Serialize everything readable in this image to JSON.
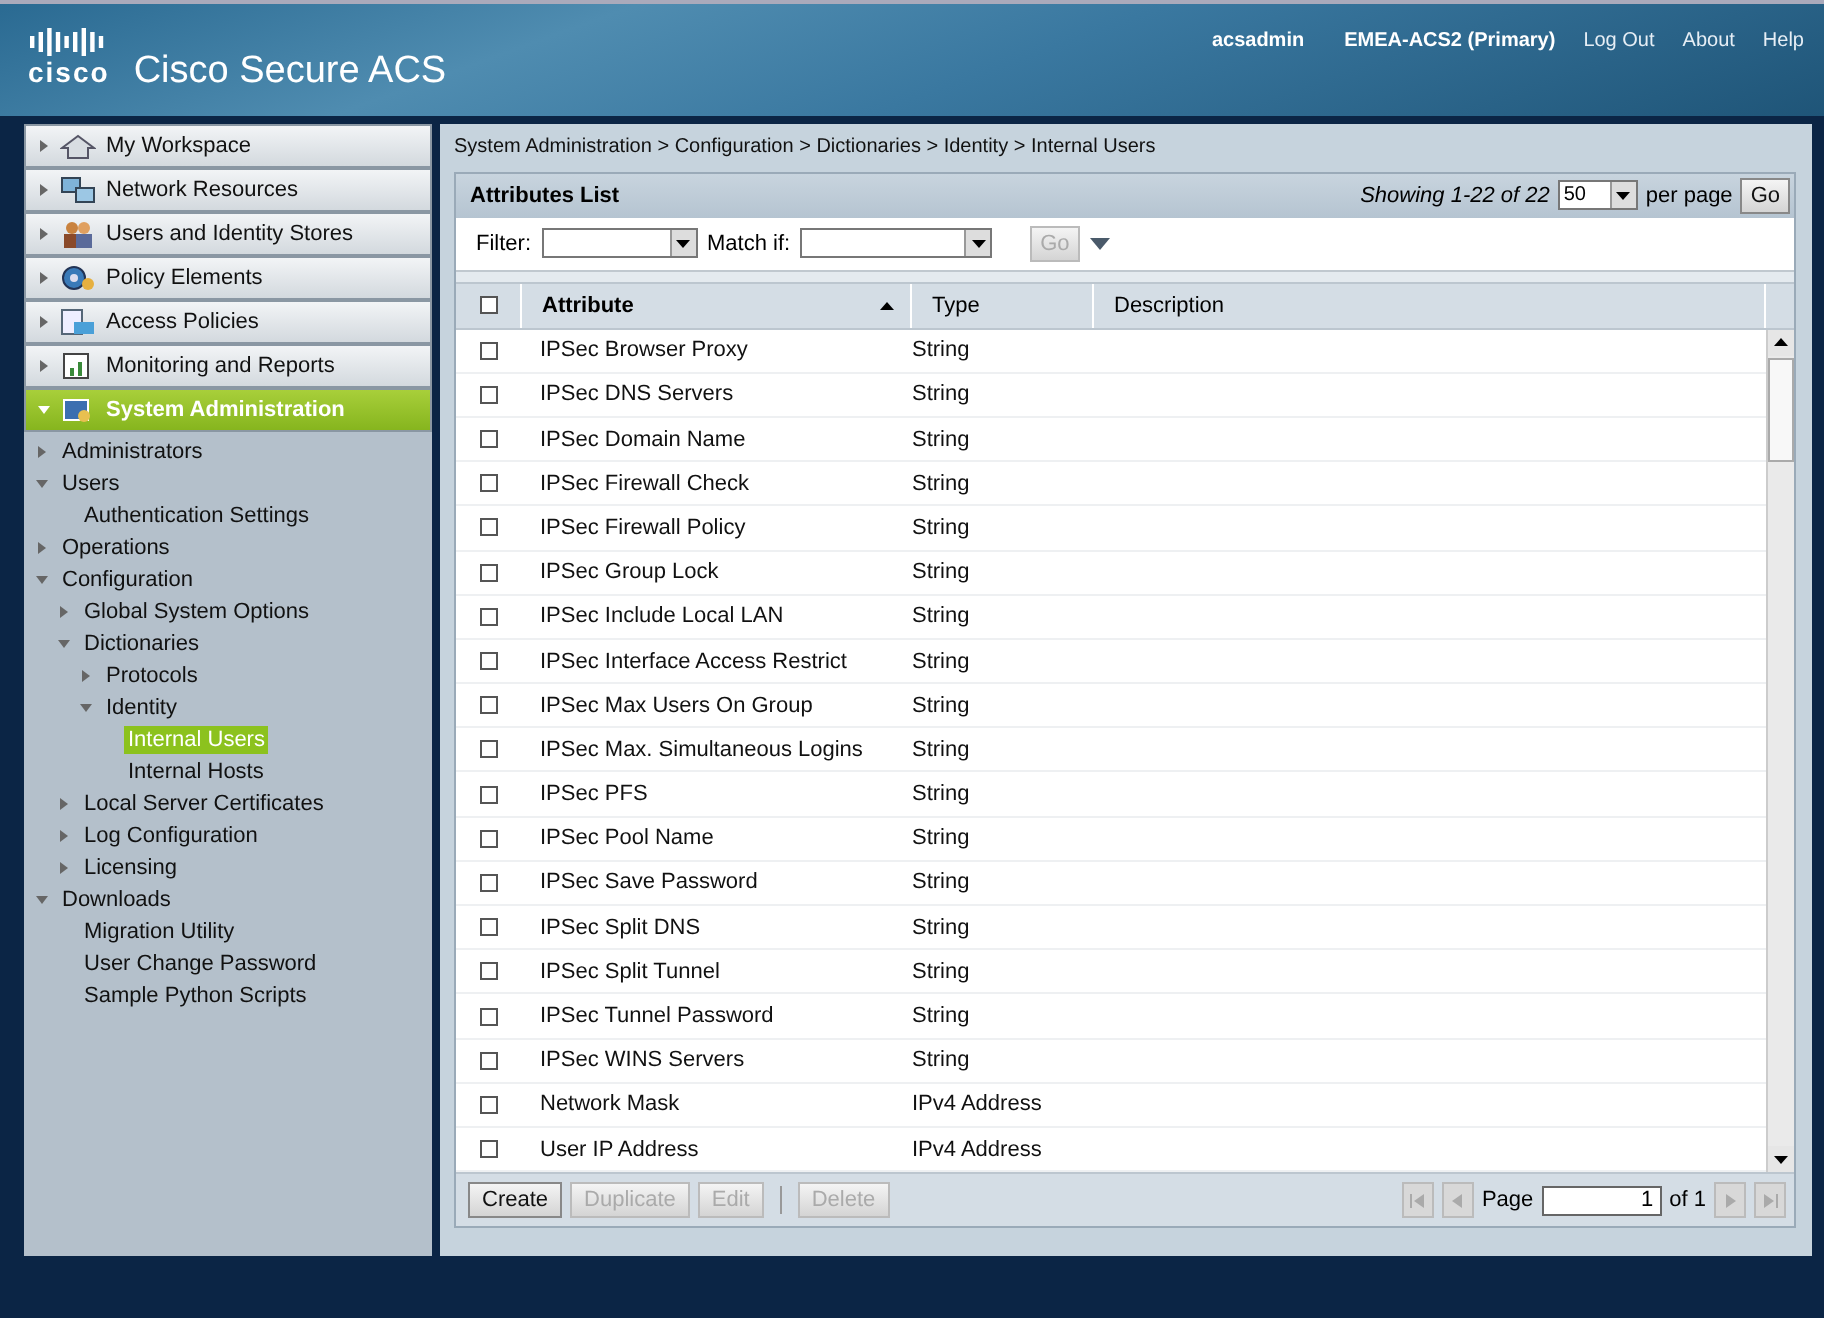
{
  "header": {
    "logo": "cisco",
    "product": "Cisco Secure ACS",
    "user": "acsadmin",
    "server": "EMEA-ACS2 (Primary)",
    "links": [
      "Log Out",
      "About",
      "Help"
    ]
  },
  "nav": [
    {
      "label": "My Workspace",
      "selected": false
    },
    {
      "label": "Network Resources",
      "selected": false
    },
    {
      "label": "Users and Identity Stores",
      "selected": false
    },
    {
      "label": "Policy Elements",
      "selected": false
    },
    {
      "label": "Access Policies",
      "selected": false
    },
    {
      "label": "Monitoring and Reports",
      "selected": false
    },
    {
      "label": "System Administration",
      "selected": true
    }
  ],
  "tree": [
    {
      "label": "Administrators",
      "expanded": false,
      "selected": false
    },
    {
      "label": "Users",
      "expanded": true,
      "selected": false,
      "children": [
        {
          "label": "Authentication Settings",
          "selected": false
        }
      ]
    },
    {
      "label": "Operations",
      "expanded": false,
      "selected": false
    },
    {
      "label": "Configuration",
      "expanded": true,
      "selected": false,
      "children": [
        {
          "label": "Global System Options",
          "expanded": false,
          "selected": false
        },
        {
          "label": "Dictionaries",
          "expanded": true,
          "selected": false,
          "children": [
            {
              "label": "Protocols",
              "expanded": false,
              "selected": false
            },
            {
              "label": "Identity",
              "expanded": true,
              "selected": false,
              "children": [
                {
                  "label": "Internal Users",
                  "selected": true
                },
                {
                  "label": "Internal Hosts",
                  "selected": false
                }
              ]
            }
          ]
        },
        {
          "label": "Local Server Certificates",
          "expanded": false,
          "selected": false
        },
        {
          "label": "Log Configuration",
          "expanded": false,
          "selected": false
        },
        {
          "label": "Licensing",
          "expanded": false,
          "selected": false
        }
      ]
    },
    {
      "label": "Downloads",
      "expanded": true,
      "selected": false,
      "children": [
        {
          "label": "Migration Utility",
          "selected": false
        },
        {
          "label": "User Change Password",
          "selected": false
        },
        {
          "label": "Sample Python Scripts",
          "selected": false
        }
      ]
    }
  ],
  "breadcrumb": "System Administration > Configuration > Dictionaries > Identity > Internal Users",
  "list": {
    "title": "Attributes List",
    "showing": "Showing 1-22 of 22",
    "per_page": "50",
    "per_page_label": "per page",
    "go": "Go"
  },
  "filter": {
    "filter_label": "Filter:",
    "match_label": "Match if:",
    "go": "Go",
    "go_disabled": true
  },
  "table": {
    "header_checked": false,
    "columns": [
      "Attribute",
      "Type",
      "Description"
    ],
    "rows": [
      {
        "attribute": "IPSec Browser Proxy",
        "type": "String",
        "checked": false
      },
      {
        "attribute": "IPSec DNS Servers",
        "type": "String",
        "checked": false
      },
      {
        "attribute": "IPSec Domain Name",
        "type": "String",
        "checked": false
      },
      {
        "attribute": "IPSec Firewall Check",
        "type": "String",
        "checked": false
      },
      {
        "attribute": "IPSec Firewall Policy",
        "type": "String",
        "checked": false
      },
      {
        "attribute": "IPSec Group Lock",
        "type": "String",
        "checked": false
      },
      {
        "attribute": "IPSec Include Local LAN",
        "type": "String",
        "checked": false
      },
      {
        "attribute": "IPSec Interface Access Restrict",
        "type": "String",
        "checked": false
      },
      {
        "attribute": "IPSec Max Users On Group",
        "type": "String",
        "checked": false
      },
      {
        "attribute": "IPSec Max. Simultaneous Logins",
        "type": "String",
        "checked": false
      },
      {
        "attribute": "IPSec PFS",
        "type": "String",
        "checked": false
      },
      {
        "attribute": "IPSec Pool Name",
        "type": "String",
        "checked": false
      },
      {
        "attribute": "IPSec Save Password",
        "type": "String",
        "checked": false
      },
      {
        "attribute": "IPSec Split DNS",
        "type": "String",
        "checked": false
      },
      {
        "attribute": "IPSec Split Tunnel",
        "type": "String",
        "checked": false
      },
      {
        "attribute": "IPSec Tunnel Password",
        "type": "String",
        "checked": false
      },
      {
        "attribute": "IPSec WINS Servers",
        "type": "String",
        "checked": false
      },
      {
        "attribute": "Network Mask",
        "type": "IPv4 Address",
        "checked": false
      },
      {
        "attribute": "User IP Address",
        "type": "IPv4 Address",
        "checked": false
      }
    ]
  },
  "actions": [
    {
      "label": "Create",
      "disabled": false
    },
    {
      "label": "Duplicate",
      "disabled": true
    },
    {
      "label": "Edit",
      "disabled": true
    },
    {
      "label": "Delete",
      "disabled": true
    }
  ],
  "pager": {
    "page_label": "Page",
    "page": "1",
    "of": "of 1"
  }
}
